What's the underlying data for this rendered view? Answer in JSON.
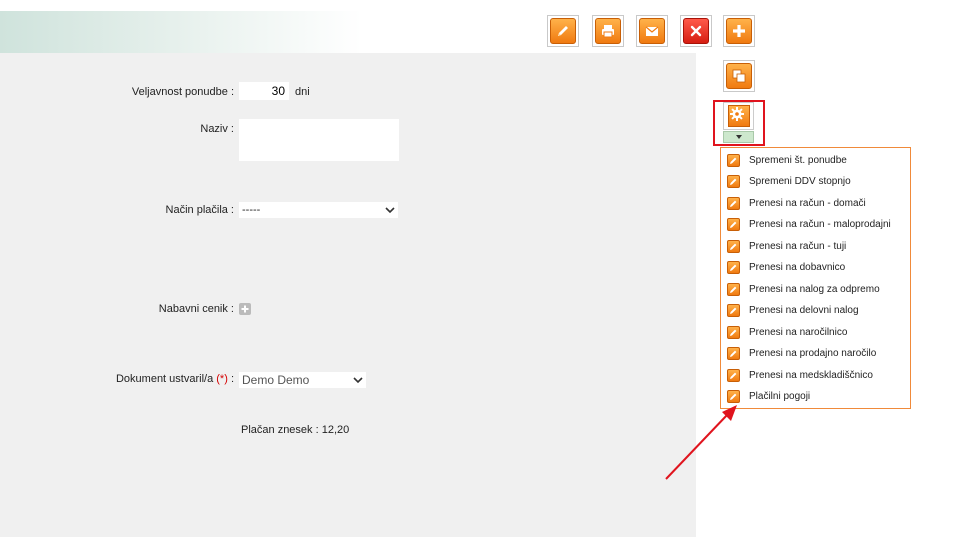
{
  "toolbar": {
    "edit_icon": "pencil-icon",
    "print_icon": "printer-icon",
    "email_icon": "envelope-icon",
    "delete_icon": "close-icon",
    "add_icon": "plus-icon",
    "copy_icon": "copy-icon",
    "settings_icon": "gear-icon",
    "dropdown_icon": "caret-down-icon"
  },
  "form": {
    "validity_label": "Veljavnost ponudbe :",
    "validity_value": "30",
    "validity_unit": "dni",
    "name_label": "Naziv :",
    "name_value": "",
    "payment_label": "Način plačila :",
    "payment_value": "-----",
    "purchase_price_label": "Nabavni cenik :",
    "created_by_label": "Dokument ustvaril/a",
    "required_mark": "(*)",
    "created_by_colon": ":",
    "created_by_value": "Demo Demo",
    "paid_amount": "Plačan znesek : 12,20"
  },
  "menu": {
    "items": [
      "Spremeni št. ponudbe",
      "Spremeni DDV stopnjo",
      "Prenesi na račun - domači",
      "Prenesi na račun - maloprodajni",
      "Prenesi na račun - tuji",
      "Prenesi na dobavnico",
      "Prenesi na nalog za odpremo",
      "Prenesi na delovni nalog",
      "Prenesi na naročilnico",
      "Prenesi na prodajno naročilo",
      "Prenesi na medskladiščnico",
      "Plačilni pogoji"
    ]
  },
  "colors": {
    "accent_orange": "#f07a10",
    "delete_red": "#d61e12",
    "highlight_red": "#e0141e",
    "menu_border": "#f08a3a"
  }
}
